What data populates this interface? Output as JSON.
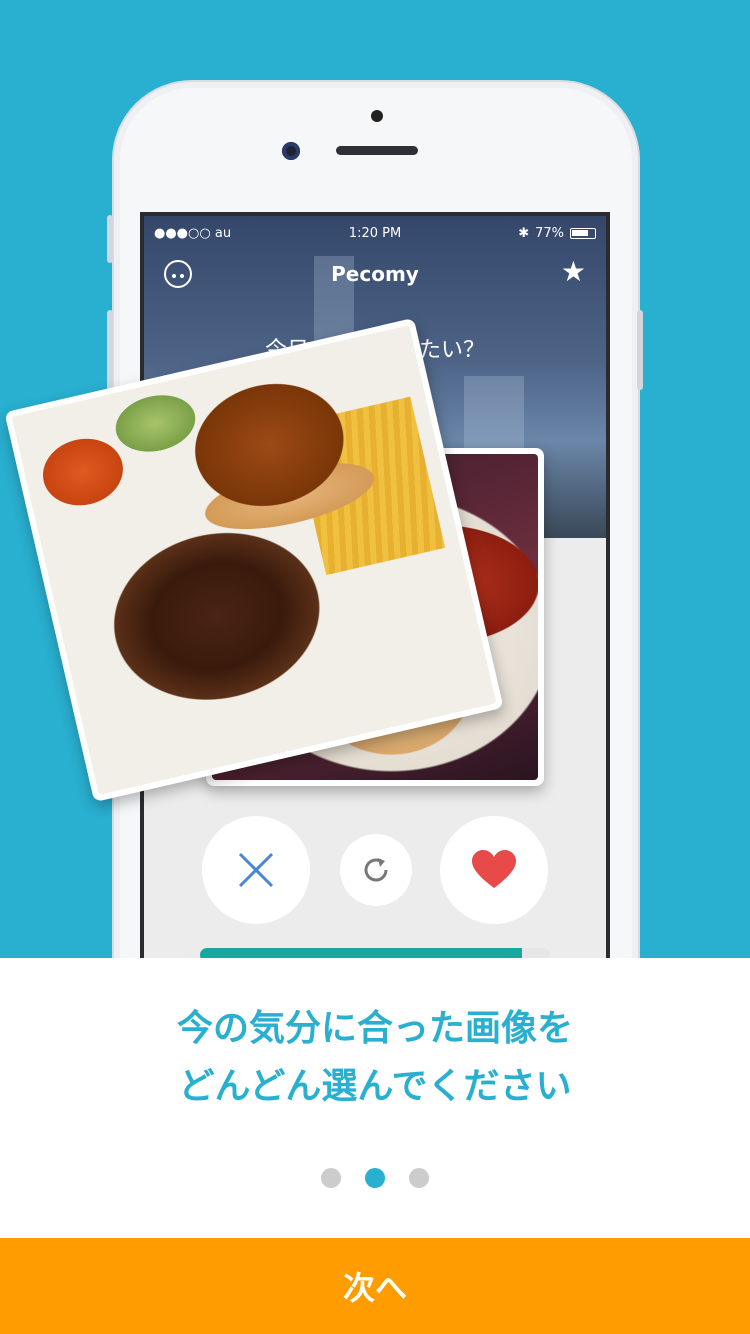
{
  "colors": {
    "accent": "#29afd0",
    "next_button": "#ff9d00",
    "progress": "#17a8a0",
    "heart": "#e84a4a",
    "cross": "#4a86d6"
  },
  "device": {
    "status": {
      "carrier": "●●●○○ au",
      "time": "1:20 PM",
      "battery": "77%"
    },
    "app": {
      "title": "Pecomy",
      "question": "今日、何が食べたい？"
    },
    "actions": {
      "dislike_icon": "cross-icon",
      "refresh_icon": "refresh-icon",
      "like_icon": "heart-icon"
    },
    "progress": 0.92
  },
  "onboarding": {
    "caption_line1": "今の気分に合った画像を",
    "caption_line2": "どんどん選んでください",
    "pages": 3,
    "current_page": 2
  },
  "next_button": {
    "label": "次へ"
  }
}
